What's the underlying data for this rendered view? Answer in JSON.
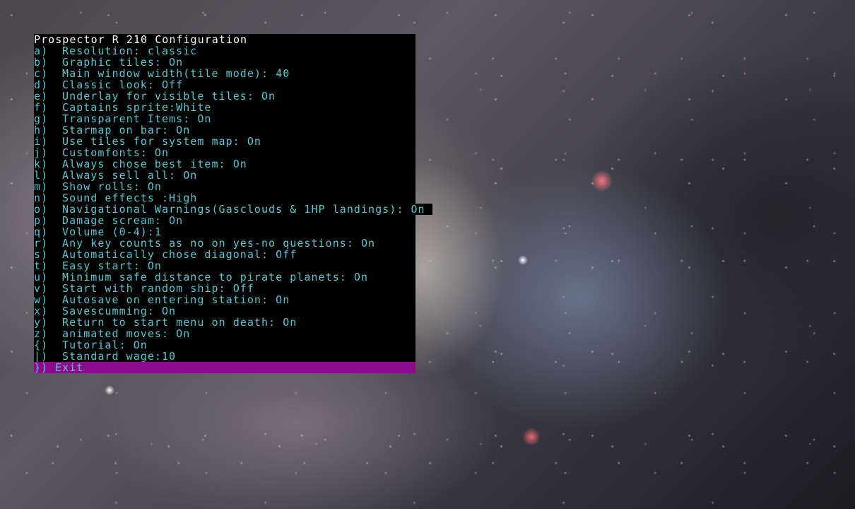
{
  "menu": {
    "title": "Prospector R 210 Configuration",
    "items": [
      {
        "key": "a)",
        "label": "Resolution: classic"
      },
      {
        "key": "b)",
        "label": "Graphic tiles: On"
      },
      {
        "key": "c)",
        "label": "Main window width(tile mode): 40"
      },
      {
        "key": "d)",
        "label": "Classic look: Off"
      },
      {
        "key": "e)",
        "label": "Underlay for visible tiles: On"
      },
      {
        "key": "f)",
        "label": "Captains sprite:White"
      },
      {
        "key": "g)",
        "label": "Transparent Items: On"
      },
      {
        "key": "h)",
        "label": "Starmap on bar: On"
      },
      {
        "key": "i)",
        "label": "Use tiles for system map: On"
      },
      {
        "key": "j)",
        "label": "Customfonts: On"
      },
      {
        "key": "k)",
        "label": "Always chose best item: On"
      },
      {
        "key": "l)",
        "label": "Always sell all: On"
      },
      {
        "key": "m)",
        "label": "Show rolls: On"
      },
      {
        "key": "n)",
        "label": "Sound effects :High"
      },
      {
        "key": "o)",
        "label": "Navigational Warnings(Gasclouds & 1HP landings): On"
      },
      {
        "key": "p)",
        "label": "Damage scream: On"
      },
      {
        "key": "q)",
        "label": "Volume (0-4):1"
      },
      {
        "key": "r)",
        "label": "Any key counts as no on yes-no questions: On"
      },
      {
        "key": "s)",
        "label": "Automatically chose diagonal: Off"
      },
      {
        "key": "t)",
        "label": "Easy start: On"
      },
      {
        "key": "u)",
        "label": "Minimum safe distance to pirate planets: On"
      },
      {
        "key": "v)",
        "label": "Start with random ship: Off"
      },
      {
        "key": "w)",
        "label": "Autosave on entering station: On"
      },
      {
        "key": "x)",
        "label": "Savescumming: On"
      },
      {
        "key": "y)",
        "label": "Return to start menu on death: On"
      },
      {
        "key": "z)",
        "label": "animated moves: On"
      },
      {
        "key": "{)",
        "label": "Tutorial: On"
      },
      {
        "key": "|)",
        "label": "Standard wage:10"
      }
    ],
    "exit": {
      "key": "})",
      "label": "Exit"
    }
  },
  "colors": {
    "option_text": "#56c8d2",
    "title_text": "#ffffff",
    "selection_bar": "#8c0a8c",
    "menu_background": "#000000"
  }
}
